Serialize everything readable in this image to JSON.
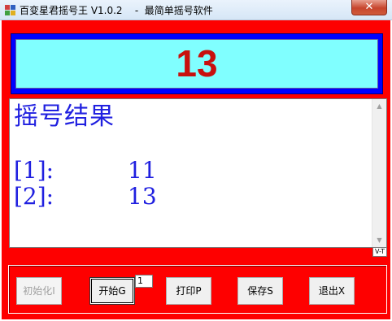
{
  "window": {
    "title": "百变星君摇号王 V1.0.2    -  最简单摇号软件",
    "close_label": "✕"
  },
  "display": {
    "current_number": "13"
  },
  "result": {
    "heading": "摇号结果",
    "entries": [
      {
        "index": "[1]:",
        "value": "11"
      },
      {
        "index": "[2]:",
        "value": "13"
      }
    ],
    "scroll_up": "▲",
    "scroll_down": "▼",
    "corner_label": "V-T"
  },
  "buttons": {
    "init": "初始化I",
    "start": "开始G",
    "count_value": "1",
    "print": "打印P",
    "save": "保存S",
    "exit": "退出X"
  },
  "colors": {
    "panel": "#fe0000",
    "display_frame": "#0000ff",
    "display_bg": "#80ffff",
    "display_number": "#c8100e",
    "result_text": "#2020e0"
  },
  "icons": {
    "app": "app-icon",
    "close": "close-icon"
  }
}
